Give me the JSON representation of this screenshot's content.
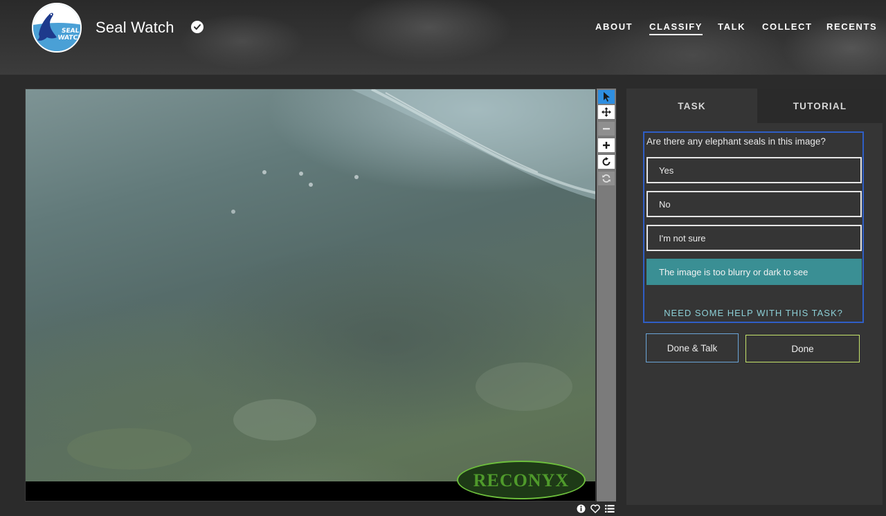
{
  "header": {
    "logo_text_line1": "SEAL",
    "logo_text_line2": "WATCH",
    "site_title": "Seal Watch",
    "nav": [
      {
        "label": "ABOUT",
        "active": false
      },
      {
        "label": "CLASSIFY",
        "active": true
      },
      {
        "label": "TALK",
        "active": false
      },
      {
        "label": "COLLECT",
        "active": false
      },
      {
        "label": "RECENTS",
        "active": false
      }
    ]
  },
  "viewer": {
    "camera_brand": "RECONYX",
    "tools": [
      "pointer-icon",
      "pan-icon",
      "zoom-out-icon",
      "zoom-in-icon",
      "rotate-icon",
      "reset-icon"
    ],
    "meta_icons": [
      "info-icon",
      "heart-icon",
      "list-icon"
    ]
  },
  "task_panel": {
    "tabs": [
      "TASK",
      "TUTORIAL"
    ],
    "question": "Are there any elephant seals in this image?",
    "answers": [
      {
        "label": "Yes",
        "selected": false
      },
      {
        "label": "No",
        "selected": false
      },
      {
        "label": "I'm not sure",
        "selected": false
      },
      {
        "label": "The image is too blurry or dark to see",
        "selected": true
      }
    ],
    "help_link": "NEED SOME HELP WITH THIS TASK?",
    "done_talk_label": "Done & Talk",
    "done_label": "Done"
  },
  "colors": {
    "selected_answer": "#3a8f94",
    "task_border": "#2f5ec6",
    "tool_selected": "#2e8ee0",
    "done_border": "#c6e56b",
    "done_talk_border": "#6ba6d9"
  }
}
